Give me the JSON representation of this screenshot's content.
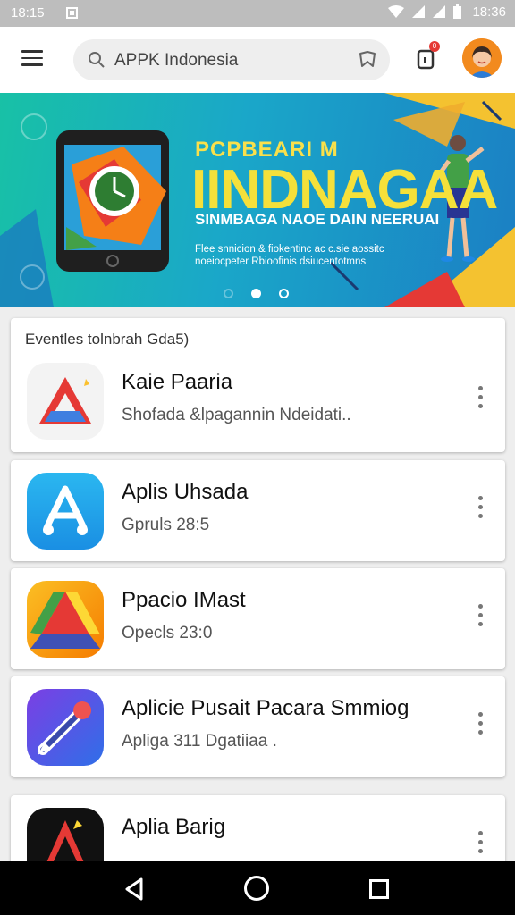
{
  "status_bar": {
    "time_left": "18:15",
    "time_right": "18:36"
  },
  "search": {
    "placeholder": "APPK Indonesia"
  },
  "notifications": {
    "count": "0"
  },
  "banner": {
    "small_title": "PCPBEARI M",
    "title": "IINDNAGAA",
    "subtitle": "SINMBAGA NAOE DAIN NEERUAI",
    "description": "Flee snnicion & fiokentinc ac c.sie aossitc noeiocpeter Rbioofinis dsiucentotmns",
    "slides": [
      "off",
      "on",
      "ring"
    ]
  },
  "section": {
    "title": "Eventles tolnbrah Gda5)"
  },
  "apps": [
    {
      "name": "Kaie Paaria",
      "meta": "Shofada &lpagannin Ndeidati..",
      "icon": "delta-logo-icon"
    },
    {
      "name": "Aplis Uhsada",
      "meta": "Gpruls 28:5",
      "icon": "app-store-icon"
    },
    {
      "name": "Ppacio IMast",
      "meta": "Opecls 23:0",
      "icon": "drive-triangle-icon"
    },
    {
      "name": "Aplicie Pusait Pacara Smmiog",
      "meta": "Apliga 311 Dgatiiaa .",
      "icon": "pen-icon"
    },
    {
      "name": "Aplia Barig",
      "meta": "",
      "icon": "triangle-dark-icon"
    }
  ],
  "colors": {
    "accent_yellow": "#f5e03a",
    "banner_teal": "#18c1a6",
    "banner_blue": "#1b7fc4"
  }
}
